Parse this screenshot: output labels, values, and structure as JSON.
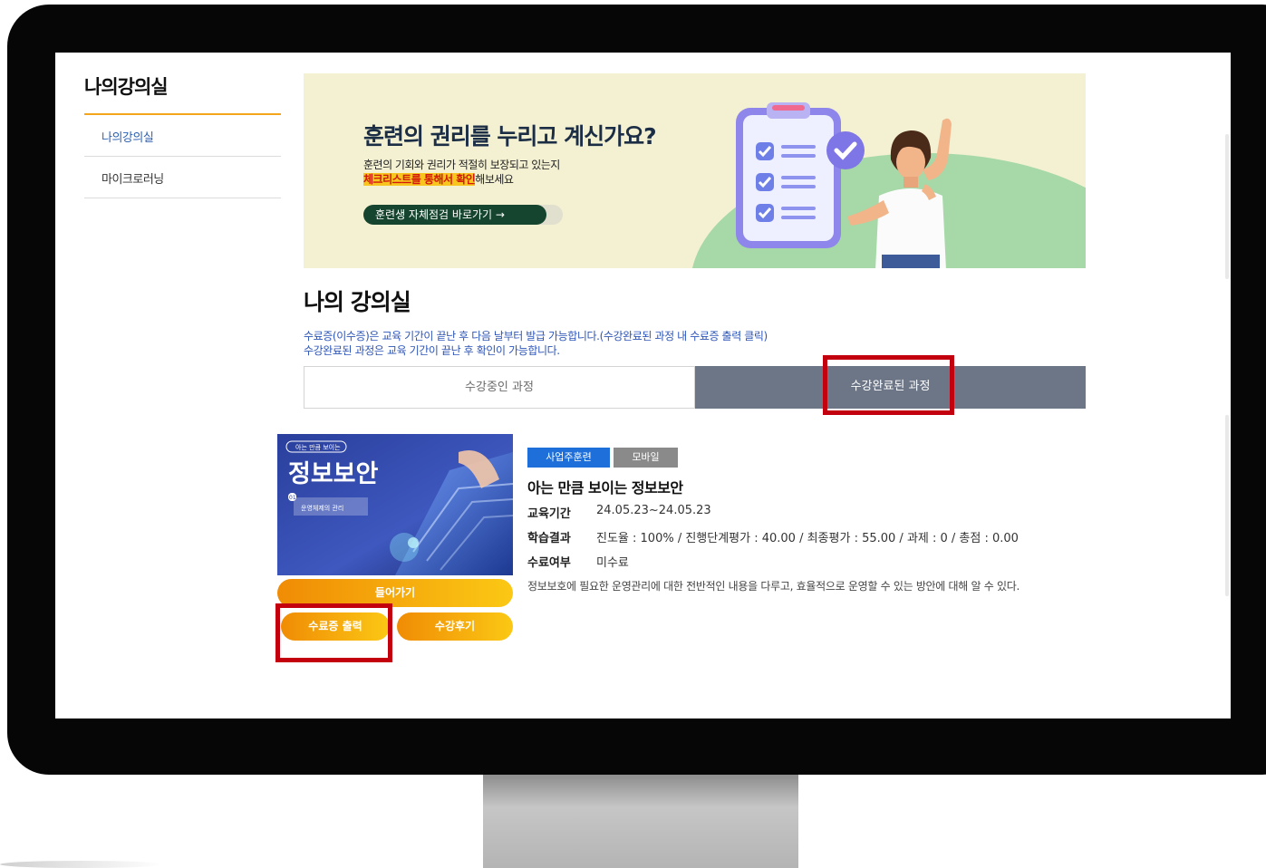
{
  "sidebar": {
    "title": "나의강의실",
    "items": [
      {
        "label": "나의강의실",
        "active": true
      },
      {
        "label": "마이크로러닝",
        "active": false
      }
    ]
  },
  "banner": {
    "headline": "훈련의 권리를 누리고 계신가요?",
    "line1": "훈련의 기회와 권리가 적절히 보장되고 있는지",
    "line2_highlight": "체크리스트를 통해서 확인",
    "line2_rest": "해보세요",
    "button_label": "훈련생 자체점검 바로가기 →"
  },
  "main": {
    "title": "나의 강의실",
    "notes": [
      "수료증(이수증)은 교육 기간이 끝난 후 다음 날부터 발급 가능합니다.(수강완료된 과정 내 수료증 출력 클릭)",
      "수강완료된 과정은 교육 기간이 끝난 후 확인이 가능합니다."
    ],
    "tabs": [
      {
        "label": "수강중인 과정",
        "active": false
      },
      {
        "label": "수강완료된 과정",
        "active": true
      }
    ]
  },
  "course": {
    "thumbnail": {
      "tag": "아는 만큼 보이는",
      "title": "정보보안",
      "number": "01",
      "subtitle": "운영체제의 관리"
    },
    "badges": [
      "사업주훈련",
      "모바일"
    ],
    "title": "아는 만큼 보이는 정보보안",
    "period_label": "교육기간",
    "period_value": "24.05.23~24.05.23",
    "result_label": "학습결과",
    "result_value": "진도율 : 100% / 진행단계평가 : 40.00 / 최종평가 : 55.00 / 과제 : 0 / 총점 : 0.00",
    "completion_label": "수료여부",
    "completion_value": "미수료",
    "description": "정보보호에 필요한 운영관리에 대한 전반적인 내용을 다루고, 효율적으로 운영할 수 있는 방안에 대해 알 수 있다.",
    "buttons": {
      "enter": "들어가기",
      "certificate": "수료증 출력",
      "review": "수강후기"
    }
  },
  "colors": {
    "accent_orange": "#f3a61b",
    "link_blue": "#2d55b8",
    "tab_active": "#6d7687",
    "badge_blue": "#1e6fd9",
    "badge_gray": "#8a8a8a",
    "highlight_red": "#c3000d"
  }
}
